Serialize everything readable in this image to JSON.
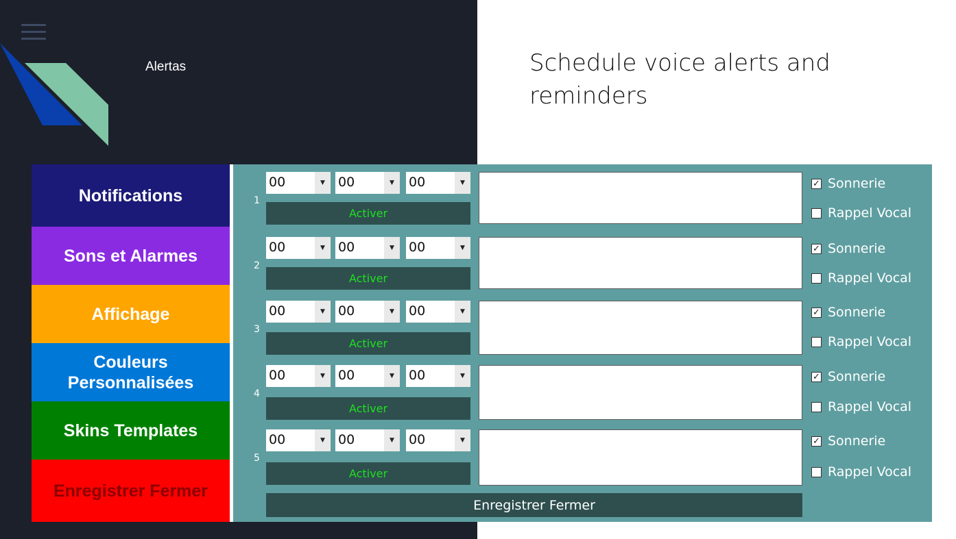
{
  "app": {
    "title": "Alertas"
  },
  "header": {
    "headline": "Schedule voice alerts and reminders"
  },
  "sidebar": {
    "items": [
      {
        "label": "Notifications",
        "bg": "#1c1a78",
        "color": "#ffffff"
      },
      {
        "label": "Sons et Alarmes",
        "bg": "#8a2be2",
        "color": "#ffffff"
      },
      {
        "label": "Affichage",
        "bg": "#ffa500",
        "color": "#ffffff"
      },
      {
        "label": "Couleurs Personnalisées",
        "bg": "#0078d7",
        "color": "#ffffff"
      },
      {
        "label": "Skins Templates",
        "bg": "#008000",
        "color": "#ffffff"
      },
      {
        "label": "Enregistrer Fermer",
        "bg": "#ff0000",
        "color": "#8b0000"
      }
    ]
  },
  "alerts": {
    "rows": [
      {
        "number": "1",
        "hour": "00",
        "minute": "00",
        "second": "00",
        "activate_label": "Activer",
        "message": "",
        "ring_label": "Sonnerie",
        "ring_checked": true,
        "voice_label": "Rappel Vocal",
        "voice_checked": false
      },
      {
        "number": "2",
        "hour": "00",
        "minute": "00",
        "second": "00",
        "activate_label": "Activer",
        "message": "",
        "ring_label": "Sonnerie",
        "ring_checked": true,
        "voice_label": "Rappel Vocal",
        "voice_checked": false
      },
      {
        "number": "3",
        "hour": "00",
        "minute": "00",
        "second": "00",
        "activate_label": "Activer",
        "message": "",
        "ring_label": "Sonnerie",
        "ring_checked": true,
        "voice_label": "Rappel Vocal",
        "voice_checked": false
      },
      {
        "number": "4",
        "hour": "00",
        "minute": "00",
        "second": "00",
        "activate_label": "Activer",
        "message": "",
        "ring_label": "Sonnerie",
        "ring_checked": true,
        "voice_label": "Rappel Vocal",
        "voice_checked": false
      },
      {
        "number": "5",
        "hour": "00",
        "minute": "00",
        "second": "00",
        "activate_label": "Activer",
        "message": "",
        "ring_label": "Sonnerie",
        "ring_checked": true,
        "voice_label": "Rappel Vocal",
        "voice_checked": false
      }
    ],
    "save_label": "Enregistrer Fermer"
  },
  "colors": {
    "left_bg": "#1b202b",
    "panel_bg": "#5f9ea0",
    "button_bg": "#2f4f4f",
    "activate_text": "#1ee01e"
  },
  "icons": {
    "menu": "hamburger-icon",
    "logo": "chevron-logo",
    "dropdown": "chevron-down-icon",
    "check": "checkmark-icon"
  }
}
